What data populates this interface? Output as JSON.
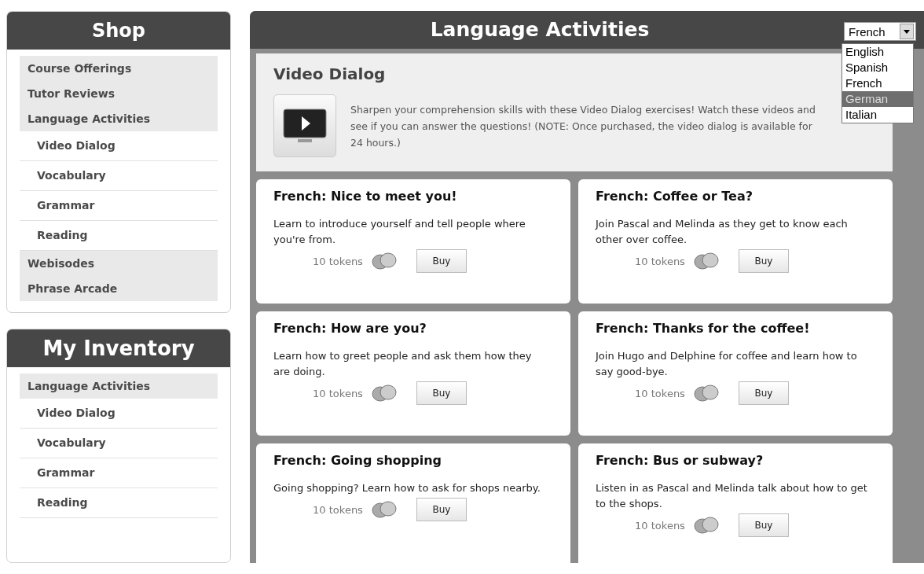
{
  "shop": {
    "title": "Shop",
    "items": [
      {
        "label": "Course Offerings"
      },
      {
        "label": "Tutor Reviews"
      },
      {
        "label": "Language Activities",
        "children": [
          {
            "label": "Video Dialog"
          },
          {
            "label": "Vocabulary"
          },
          {
            "label": "Grammar"
          },
          {
            "label": "Reading"
          }
        ]
      },
      {
        "label": "Webisodes"
      },
      {
        "label": "Phrase Arcade"
      }
    ]
  },
  "inventory": {
    "title": "My Inventory",
    "items": [
      {
        "label": "Language Activities",
        "children": [
          {
            "label": "Video Dialog"
          },
          {
            "label": "Vocabulary"
          },
          {
            "label": "Grammar"
          },
          {
            "label": "Reading"
          }
        ]
      }
    ]
  },
  "main": {
    "title": "Language Activities",
    "language_select": {
      "value": "French",
      "options": [
        {
          "label": "English",
          "highlighted": false
        },
        {
          "label": "Spanish",
          "highlighted": false
        },
        {
          "label": "French",
          "highlighted": false
        },
        {
          "label": "German",
          "highlighted": true
        },
        {
          "label": "Italian",
          "highlighted": false
        }
      ]
    },
    "intro": {
      "title": "Video Dialog",
      "text": "Sharpen your comprehension skills with these Video Dialog exercises! Watch these videos and see if you can answer the questions! (NOTE: Once purchased, the video dialog is available for 24 hours.)"
    },
    "cards": [
      {
        "title": "French: Nice to meet you!",
        "description": "Learn to introduce yourself and tell people where you're from.",
        "price": "10 tokens",
        "button": "Buy"
      },
      {
        "title": "French: Coffee or Tea?",
        "description": "Join Pascal and Melinda as they get to know each other over coffee.",
        "price": "10 tokens",
        "button": "Buy"
      },
      {
        "title": "French: How are you?",
        "description": "Learn how to greet people and ask them how they are doing.",
        "price": "10 tokens",
        "button": "Buy"
      },
      {
        "title": "French: Thanks for the coffee!",
        "description": "Join Hugo and Delphine for coffee and learn how to say good-bye.",
        "price": "10 tokens",
        "button": "Buy"
      },
      {
        "title": "French: Going shopping",
        "description": "Going shopping? Learn how to ask for shops nearby.",
        "price": "10 tokens",
        "button": "Buy"
      },
      {
        "title": "French: Bus or subway?",
        "description": "Listen in as Pascal and Melinda talk about how to get to the shops.",
        "price": "10 tokens",
        "button": "Buy"
      }
    ]
  }
}
